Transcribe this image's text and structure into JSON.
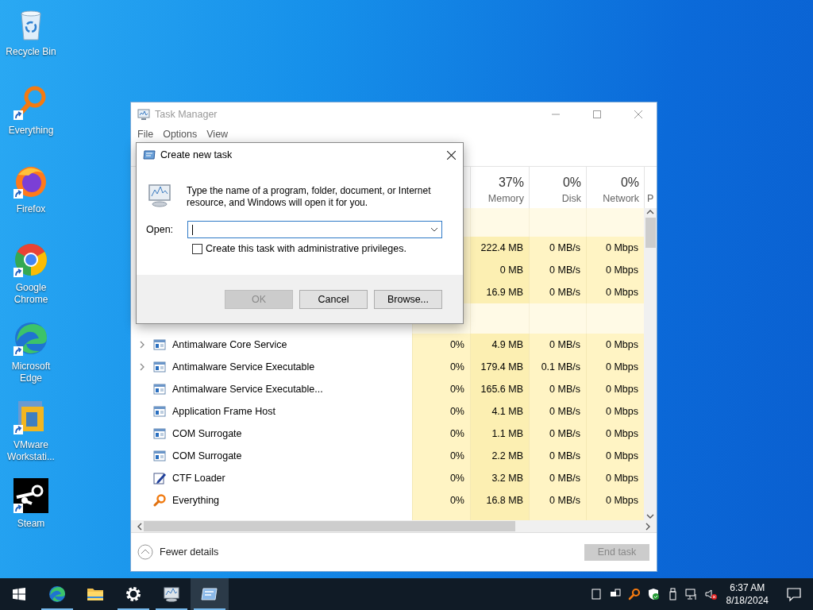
{
  "desktop_icons": [
    {
      "label": "Recycle Bin",
      "kind": "recycle",
      "shortcut": false
    },
    {
      "label": "Everything",
      "kind": "everything",
      "shortcut": true
    },
    {
      "label": "Firefox",
      "kind": "firefox",
      "shortcut": true
    },
    {
      "label": "Google Chrome",
      "kind": "chrome",
      "shortcut": true
    },
    {
      "label": "Microsoft Edge",
      "kind": "edge",
      "shortcut": true
    },
    {
      "label": "VMware Workstati...",
      "kind": "vmware",
      "shortcut": true
    },
    {
      "label": "Steam",
      "kind": "steam",
      "shortcut": true
    }
  ],
  "task_manager": {
    "title": "Task Manager",
    "menu": [
      "File",
      "Options",
      "View"
    ],
    "columns": [
      {
        "percent": "37%",
        "label": "Memory"
      },
      {
        "percent": "0%",
        "label": "Disk"
      },
      {
        "percent": "0%",
        "label": "Network"
      },
      {
        "label": "P"
      }
    ],
    "app_rows": [
      {
        "memory": "222.4 MB",
        "disk": "0 MB/s",
        "network": "0 Mbps"
      },
      {
        "memory": "0 MB",
        "disk": "0 MB/s",
        "network": "0 Mbps"
      },
      {
        "memory": "16.9 MB",
        "disk": "0 MB/s",
        "network": "0 Mbps"
      }
    ],
    "process_rows": [
      {
        "name": "Antimalware Core Service",
        "expandable": true,
        "kind": "service",
        "cpu": "0%",
        "memory": "4.9 MB",
        "disk": "0 MB/s",
        "network": "0 Mbps"
      },
      {
        "name": "Antimalware Service Executable",
        "expandable": true,
        "kind": "service",
        "cpu": "0%",
        "memory": "179.4 MB",
        "disk": "0.1 MB/s",
        "network": "0 Mbps"
      },
      {
        "name": "Antimalware Service Executable...",
        "expandable": false,
        "kind": "service",
        "cpu": "0%",
        "memory": "165.6 MB",
        "disk": "0 MB/s",
        "network": "0 Mbps"
      },
      {
        "name": "Application Frame Host",
        "expandable": false,
        "kind": "service",
        "cpu": "0%",
        "memory": "4.1 MB",
        "disk": "0 MB/s",
        "network": "0 Mbps"
      },
      {
        "name": "COM Surrogate",
        "expandable": false,
        "kind": "service",
        "cpu": "0%",
        "memory": "1.1 MB",
        "disk": "0 MB/s",
        "network": "0 Mbps"
      },
      {
        "name": "COM Surrogate",
        "expandable": false,
        "kind": "service",
        "cpu": "0%",
        "memory": "2.2 MB",
        "disk": "0 MB/s",
        "network": "0 Mbps"
      },
      {
        "name": "CTF Loader",
        "expandable": false,
        "kind": "pen",
        "cpu": "0%",
        "memory": "3.2 MB",
        "disk": "0 MB/s",
        "network": "0 Mbps"
      },
      {
        "name": "Everything",
        "expandable": false,
        "kind": "magnifier",
        "cpu": "0%",
        "memory": "16.8 MB",
        "disk": "0 MB/s",
        "network": "0 Mbps"
      }
    ],
    "fewer_details": "Fewer details",
    "end_task": {
      "label": "End task",
      "disabled": true
    }
  },
  "dialog": {
    "title": "Create new task",
    "message": "Type the name of a program, folder, document, or Internet resource, and Windows will open it for you.",
    "open_label": "Open:",
    "admin_checkbox": {
      "label": "Create this task with administrative privileges.",
      "checked": false
    },
    "buttons": [
      {
        "label": "OK",
        "disabled": true
      },
      {
        "label": "Cancel",
        "disabled": false
      },
      {
        "label": "Browse...",
        "disabled": false
      }
    ]
  },
  "taskbar": {
    "apps": [
      {
        "kind": "edge",
        "running": true,
        "selected": false
      },
      {
        "kind": "folder",
        "running": false,
        "selected": false
      },
      {
        "kind": "gear",
        "running": true,
        "selected": false
      },
      {
        "kind": "monitor",
        "running": true,
        "selected": false
      },
      {
        "kind": "run",
        "running": true,
        "selected": true
      }
    ],
    "time": "6:37 AM",
    "date": "8/18/2024"
  }
}
